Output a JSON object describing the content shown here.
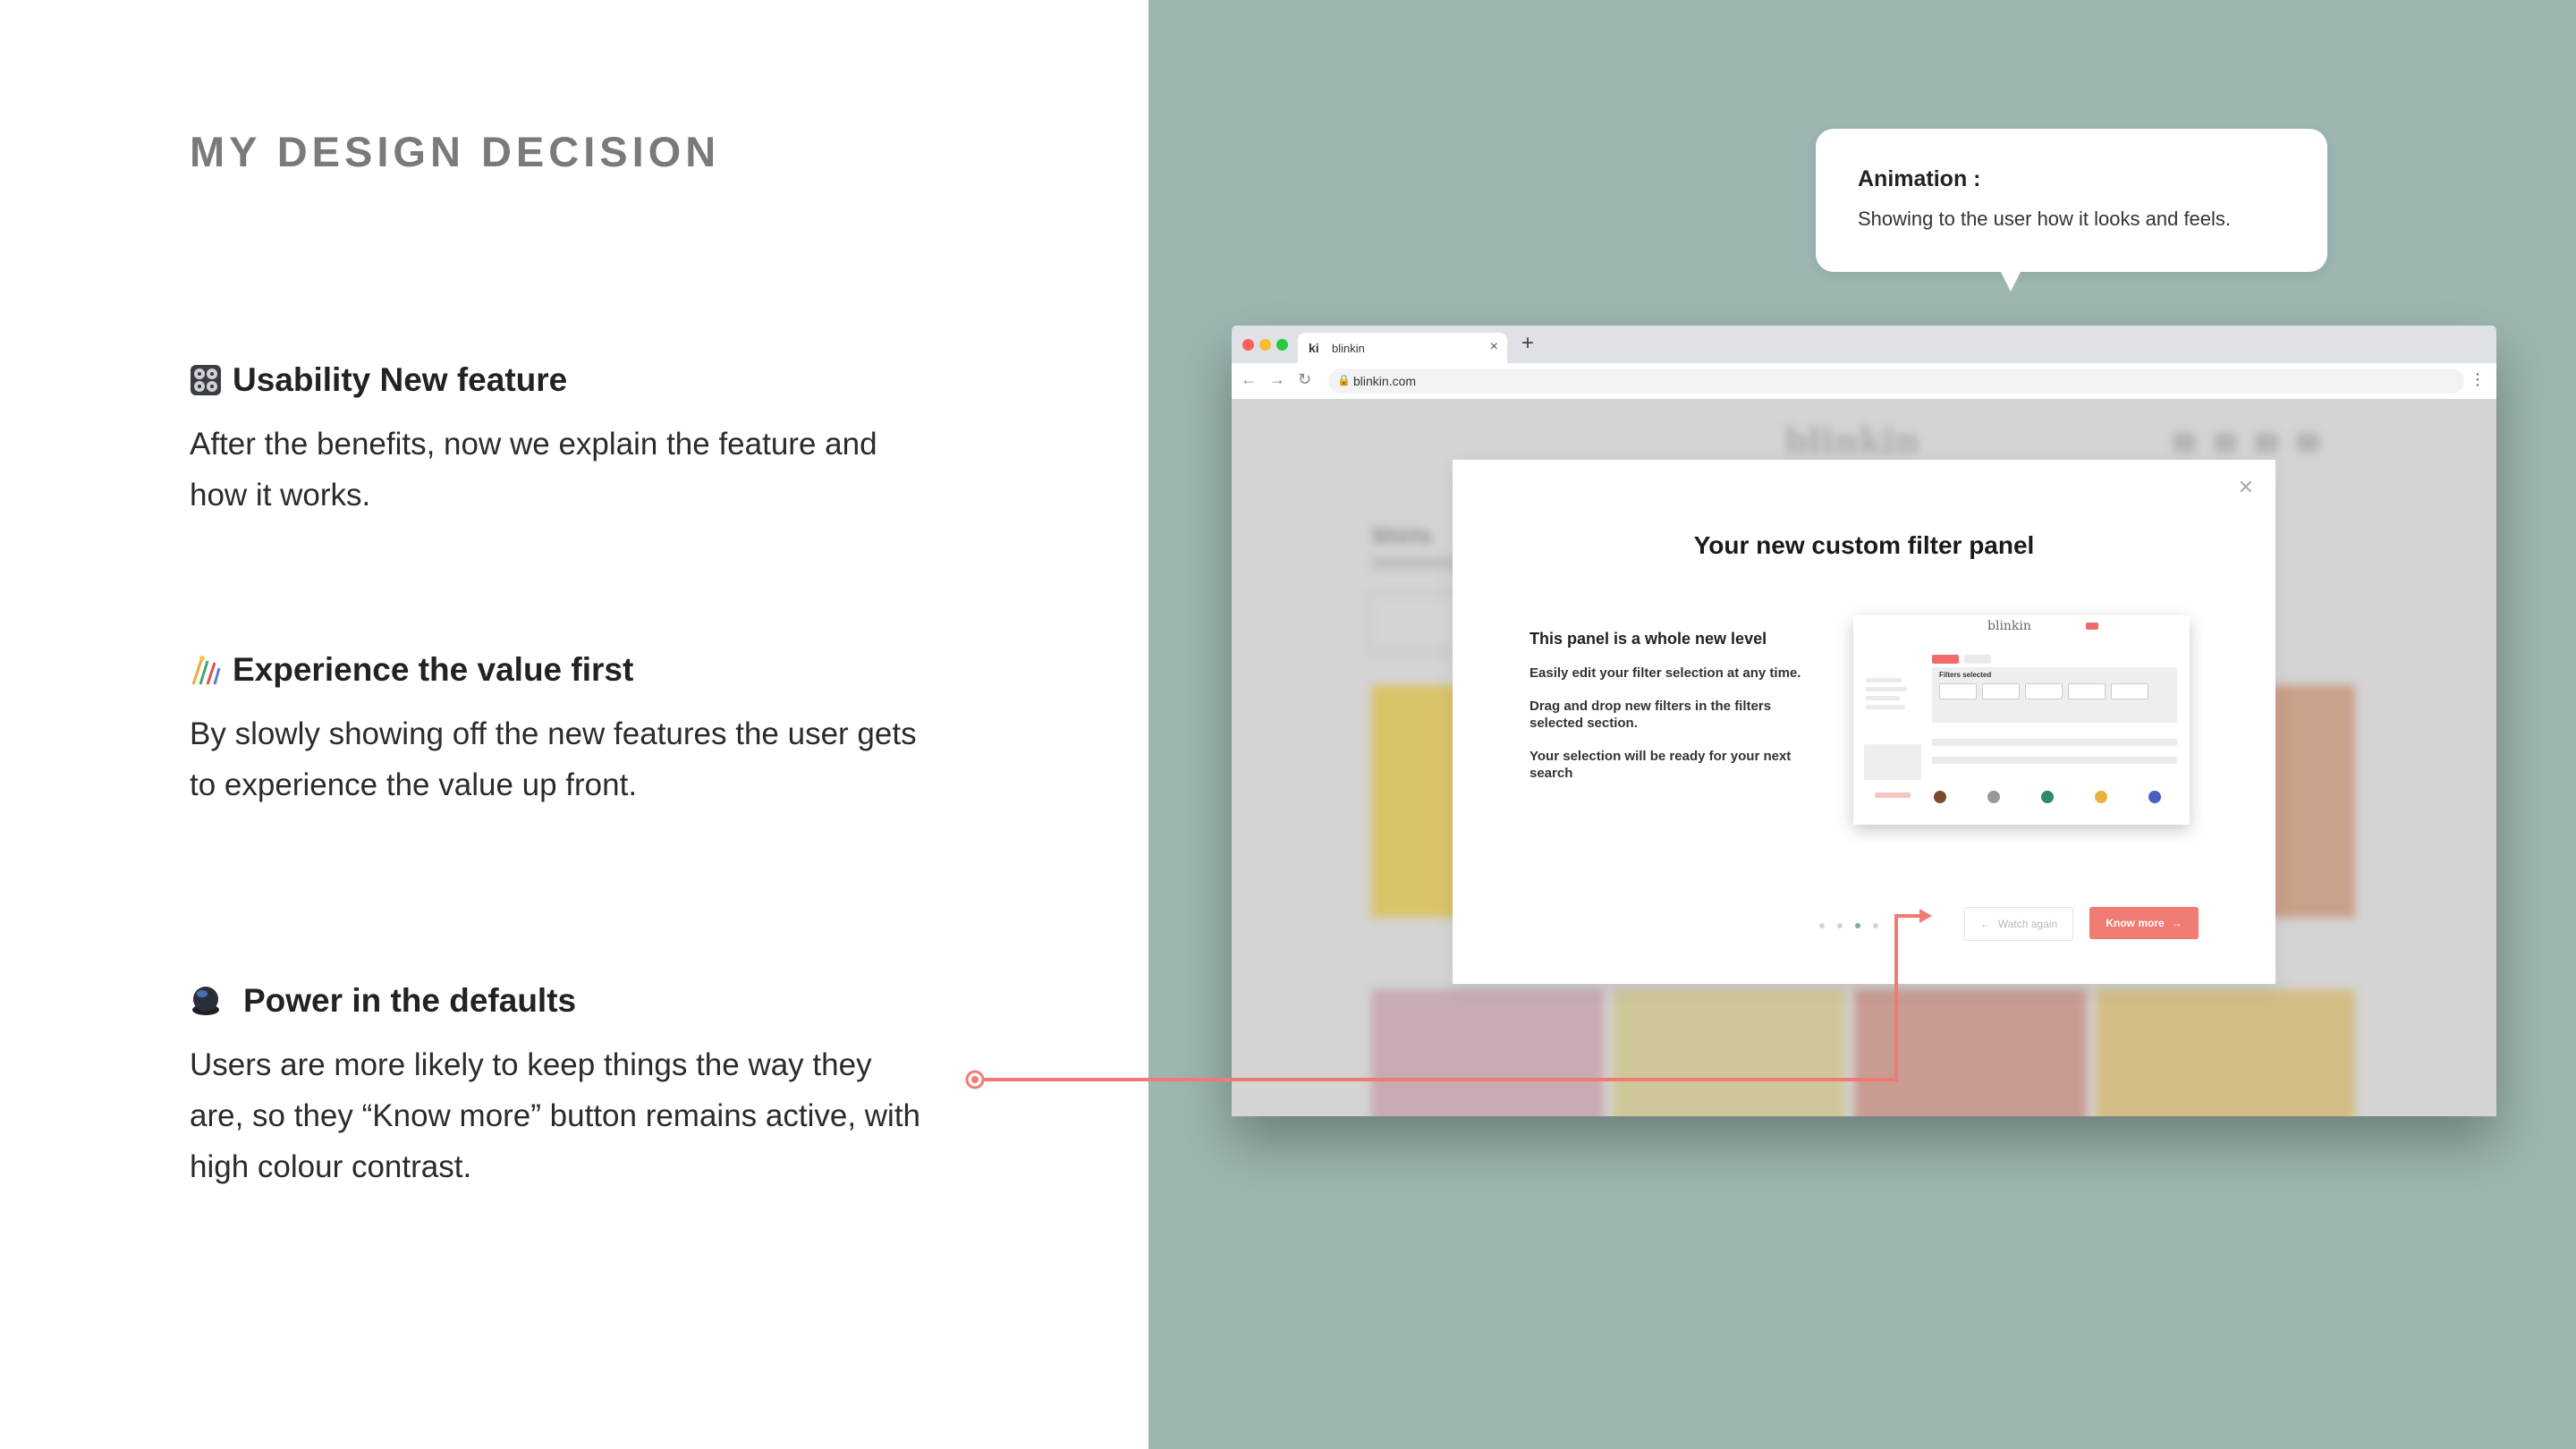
{
  "left": {
    "title": "MY DESIGN DECISION",
    "sections": [
      {
        "icon": "control-knobs-icon",
        "heading": "Usability New feature",
        "body": "After the benefits, now we explain the feature and how it works."
      },
      {
        "icon": "sparkler-chart-icon",
        "heading": "Experience the value first",
        "body": "By slowly showing off the new features the user gets to experience the value up front."
      },
      {
        "icon": "dark-orb-icon",
        "heading": "Power in the defaults",
        "body": "Users are more likely to keep things the way they are, so they “Know more” button remains active, with high colour contrast."
      }
    ]
  },
  "callout": {
    "title": "Animation :",
    "body": "Showing to the user how it looks and feels."
  },
  "browser": {
    "tab_title": "blinkin",
    "favicon_text": "ki",
    "url": "blinkin.com"
  },
  "site": {
    "brand": "blinkin",
    "page_heading": "Shirts"
  },
  "modal": {
    "title": "Your new custom filter panel",
    "subtitle": "This panel is a whole new level",
    "points": [
      "Easily edit your filter selection at any time.",
      "Drag and drop new filters in the filters selected section.",
      "Your selection will be ready for your next search"
    ],
    "preview_brand": "blinkin",
    "preview_filters_label": "Filters selected",
    "watch_again": "Watch again",
    "know_more": "Know more",
    "pager_active_index": 2,
    "pager_count": 4
  },
  "colors": {
    "right_bg": "#9db6b1",
    "accent": "#f07b73",
    "title_gray": "#7a7a7a"
  }
}
